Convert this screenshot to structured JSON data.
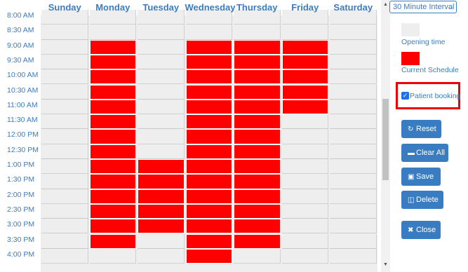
{
  "days": [
    "Sunday",
    "Monday",
    "Tuesday",
    "Wednesday",
    "Thursday",
    "Friday",
    "Saturday"
  ],
  "times": [
    "8:00 AM",
    "8:30 AM",
    "9:00 AM",
    "9:30 AM",
    "10:00 AM",
    "10:30 AM",
    "11:00 AM",
    "11:30 AM",
    "12:00 PM",
    "12:30 PM",
    "1:00 PM",
    "1:30 PM",
    "2:00 PM",
    "2:30 PM",
    "3:00 PM",
    "3:30 PM",
    "4:00 PM"
  ],
  "schedule": {
    "booked": {
      "Monday": [
        "9:00 AM",
        "9:30 AM",
        "10:00 AM",
        "10:30 AM",
        "11:00 AM",
        "11:30 AM",
        "12:00 PM",
        "12:30 PM",
        "1:00 PM",
        "1:30 PM",
        "2:00 PM",
        "2:30 PM",
        "3:00 PM",
        "3:30 PM"
      ],
      "Tuesday": [
        "1:00 PM",
        "1:30 PM",
        "2:00 PM",
        "2:30 PM",
        "3:00 PM"
      ],
      "Wednesday": [
        "9:00 AM",
        "9:30 AM",
        "10:00 AM",
        "10:30 AM",
        "11:00 AM",
        "11:30 AM",
        "12:00 PM",
        "12:30 PM",
        "1:00 PM",
        "1:30 PM",
        "2:00 PM",
        "2:30 PM",
        "3:00 PM",
        "3:30 PM",
        "4:00 PM"
      ],
      "Thursday": [
        "9:00 AM",
        "9:30 AM",
        "10:00 AM",
        "10:30 AM",
        "11:00 AM",
        "11:30 AM",
        "12:00 PM",
        "12:30 PM",
        "1:00 PM",
        "1:30 PM",
        "2:00 PM",
        "2:30 PM",
        "3:00 PM",
        "3:30 PM"
      ],
      "Friday": [
        "9:00 AM",
        "9:30 AM",
        "10:00 AM",
        "10:30 AM",
        "11:00 AM"
      ]
    }
  },
  "controls": {
    "interval": "30 Minute Interval",
    "legend_opening": "Opening time",
    "legend_current": "Current Schedule",
    "patient_booking": "Patient booking",
    "patient_booking_checked": true
  },
  "buttons": {
    "reset": "Reset",
    "clear_all": "Clear All",
    "save": "Save",
    "delete": "Delete",
    "close": "Close"
  },
  "colors": {
    "accent": "#3a7cc1",
    "booked": "#ff0000",
    "opening": "#eeeeee",
    "highlight": "#ee0000"
  }
}
